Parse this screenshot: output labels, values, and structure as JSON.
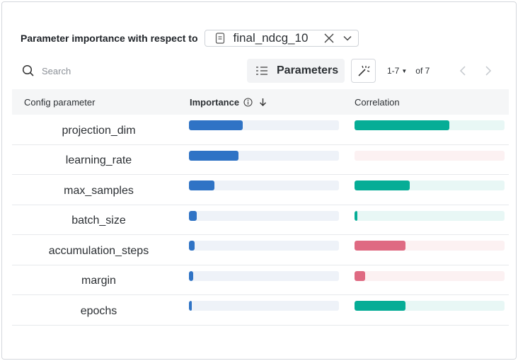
{
  "header": {
    "label": "Parameter importance with respect to",
    "metric": "final_ndcg_10",
    "icons": {
      "doc": "document-icon",
      "clear": "close-icon",
      "open": "chevron-down-icon"
    }
  },
  "toolbar": {
    "search_placeholder": "Search",
    "parameters_label": "Parameters",
    "page_range": "1-7",
    "page_total": "of 7"
  },
  "table": {
    "col_param": "Config parameter",
    "col_importance": "Importance",
    "col_correlation": "Correlation",
    "sort": "descending",
    "rows": [
      {
        "name": "projection_dim",
        "importance": 0.36,
        "correlation": 0.63
      },
      {
        "name": "learning_rate",
        "importance": 0.33,
        "correlation": -0.0
      },
      {
        "name": "max_samples",
        "importance": 0.17,
        "correlation": 0.37
      },
      {
        "name": "batch_size",
        "importance": 0.05,
        "correlation": 0.02
      },
      {
        "name": "accumulation_steps",
        "importance": 0.04,
        "correlation": -0.34
      },
      {
        "name": "margin",
        "importance": 0.03,
        "correlation": -0.07
      },
      {
        "name": "epochs",
        "importance": 0.02,
        "correlation": 0.34
      }
    ]
  },
  "colors": {
    "importance": "#2f73c5",
    "positive": "#06ad96",
    "negative": "#df6a82"
  }
}
